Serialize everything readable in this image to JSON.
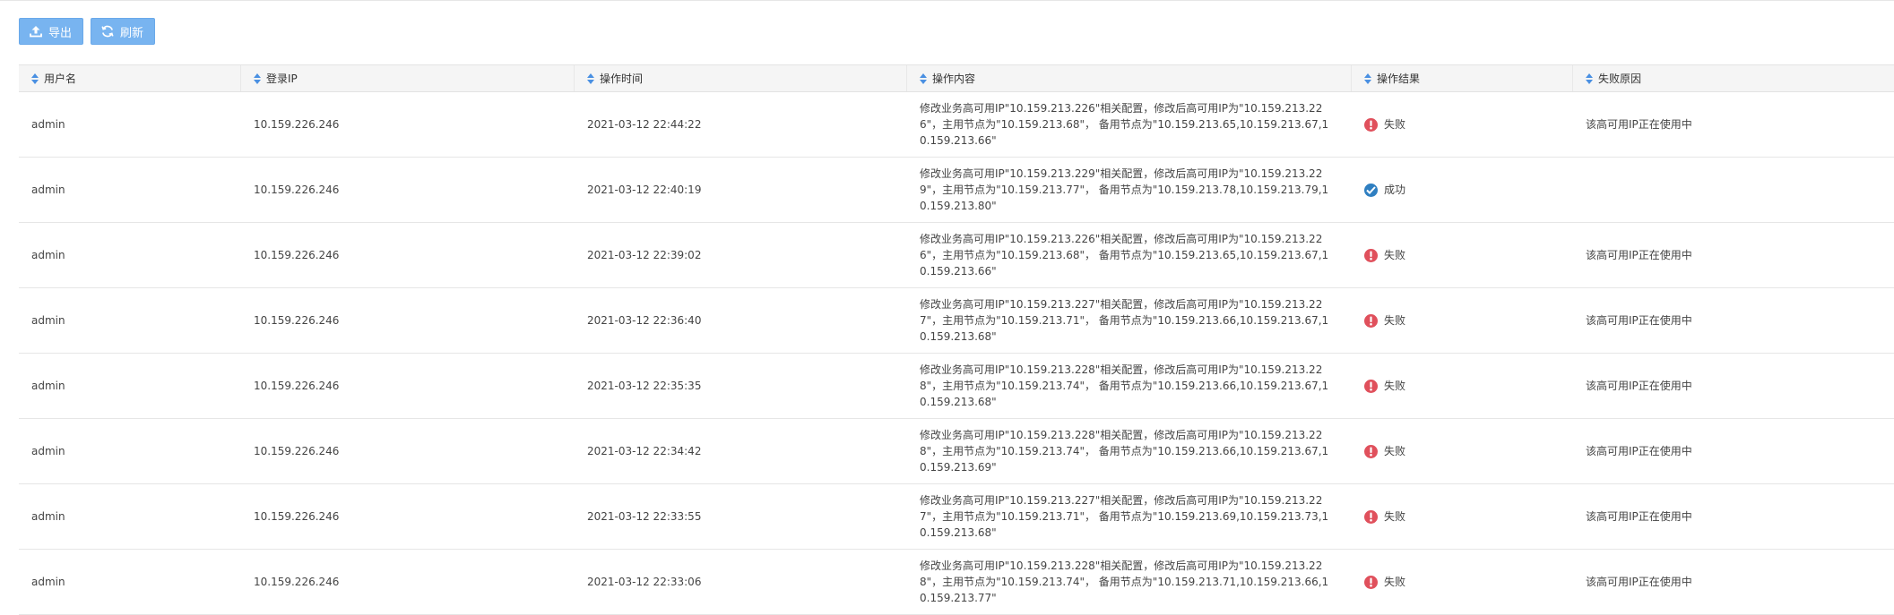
{
  "toolbar": {
    "export_label": "导出",
    "refresh_label": "刷新"
  },
  "colors": {
    "button": "#78b4f0",
    "sort_arrow": "#4a90e2",
    "fail": "#e0505c",
    "success": "#2f7fc1",
    "header_bg": "#f5f5f5"
  },
  "table": {
    "columns": [
      "用户名",
      "登录IP",
      "操作时间",
      "操作内容",
      "操作结果",
      "失败原因"
    ],
    "rows": [
      {
        "user": "admin",
        "ip": "10.159.226.246",
        "time": "2021-03-12 22:44:22",
        "content": "修改业务高可用IP\"10.159.213.226\"相关配置，修改后高可用IP为\"10.159.213.226\"，主用节点为\"10.159.213.68\"， 备用节点为\"10.159.213.65,10.159.213.67,10.159.213.66\"",
        "status": "fail",
        "result": "失败",
        "reason": "该高可用IP正在使用中"
      },
      {
        "user": "admin",
        "ip": "10.159.226.246",
        "time": "2021-03-12 22:40:19",
        "content": "修改业务高可用IP\"10.159.213.229\"相关配置，修改后高可用IP为\"10.159.213.229\"，主用节点为\"10.159.213.77\"， 备用节点为\"10.159.213.78,10.159.213.79,10.159.213.80\"",
        "status": "success",
        "result": "成功",
        "reason": ""
      },
      {
        "user": "admin",
        "ip": "10.159.226.246",
        "time": "2021-03-12 22:39:02",
        "content": "修改业务高可用IP\"10.159.213.226\"相关配置，修改后高可用IP为\"10.159.213.226\"，主用节点为\"10.159.213.68\"， 备用节点为\"10.159.213.65,10.159.213.67,10.159.213.66\"",
        "status": "fail",
        "result": "失败",
        "reason": "该高可用IP正在使用中"
      },
      {
        "user": "admin",
        "ip": "10.159.226.246",
        "time": "2021-03-12 22:36:40",
        "content": "修改业务高可用IP\"10.159.213.227\"相关配置，修改后高可用IP为\"10.159.213.227\"，主用节点为\"10.159.213.71\"， 备用节点为\"10.159.213.66,10.159.213.67,10.159.213.68\"",
        "status": "fail",
        "result": "失败",
        "reason": "该高可用IP正在使用中"
      },
      {
        "user": "admin",
        "ip": "10.159.226.246",
        "time": "2021-03-12 22:35:35",
        "content": "修改业务高可用IP\"10.159.213.228\"相关配置，修改后高可用IP为\"10.159.213.228\"，主用节点为\"10.159.213.74\"， 备用节点为\"10.159.213.66,10.159.213.67,10.159.213.68\"",
        "status": "fail",
        "result": "失败",
        "reason": "该高可用IP正在使用中"
      },
      {
        "user": "admin",
        "ip": "10.159.226.246",
        "time": "2021-03-12 22:34:42",
        "content": "修改业务高可用IP\"10.159.213.228\"相关配置，修改后高可用IP为\"10.159.213.228\"，主用节点为\"10.159.213.74\"， 备用节点为\"10.159.213.66,10.159.213.67,10.159.213.69\"",
        "status": "fail",
        "result": "失败",
        "reason": "该高可用IP正在使用中"
      },
      {
        "user": "admin",
        "ip": "10.159.226.246",
        "time": "2021-03-12 22:33:55",
        "content": "修改业务高可用IP\"10.159.213.227\"相关配置，修改后高可用IP为\"10.159.213.227\"，主用节点为\"10.159.213.71\"， 备用节点为\"10.159.213.69,10.159.213.73,10.159.213.68\"",
        "status": "fail",
        "result": "失败",
        "reason": "该高可用IP正在使用中"
      },
      {
        "user": "admin",
        "ip": "10.159.226.246",
        "time": "2021-03-12 22:33:06",
        "content": "修改业务高可用IP\"10.159.213.228\"相关配置，修改后高可用IP为\"10.159.213.228\"，主用节点为\"10.159.213.74\"， 备用节点为\"10.159.213.71,10.159.213.66,10.159.213.77\"",
        "status": "fail",
        "result": "失败",
        "reason": "该高可用IP正在使用中"
      }
    ]
  }
}
